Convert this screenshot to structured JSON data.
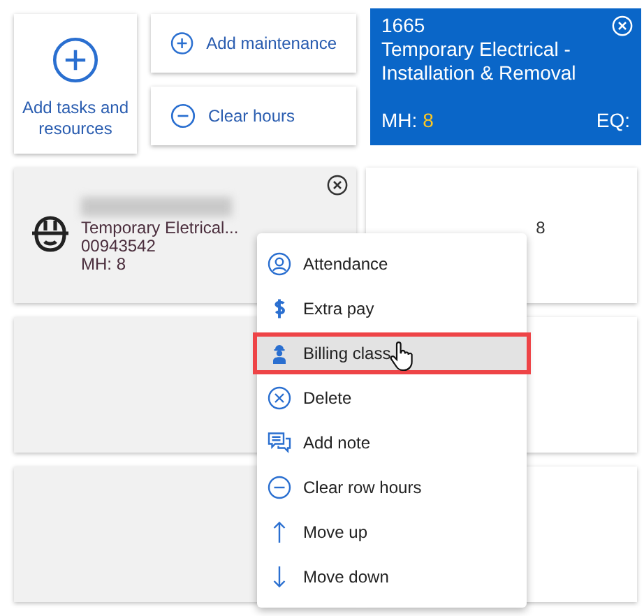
{
  "actions": {
    "add_tasks": "Add tasks and resources",
    "add_maintenance": "Add maintenance",
    "clear_hours": "Clear hours"
  },
  "task_card": {
    "number": "1665",
    "title": "Temporary Electrical - Installation & Removal",
    "mh_label": "MH:",
    "mh_value": "8",
    "eq_label": "EQ:"
  },
  "rows": [
    {
      "kind": "resource",
      "task": "Temporary Eletrical...",
      "id": "00943542",
      "mh": "MH: 8",
      "hours": "8"
    },
    {
      "kind": "empty"
    },
    {
      "kind": "empty"
    }
  ],
  "context_menu": {
    "items": [
      {
        "kind": "attendance",
        "label": "Attendance",
        "selected": false
      },
      {
        "kind": "pay",
        "label": "Extra pay",
        "selected": false
      },
      {
        "kind": "billing",
        "label": "Billing class",
        "selected": true
      },
      {
        "kind": "delete",
        "label": "Delete",
        "selected": false
      },
      {
        "kind": "note",
        "label": "Add note",
        "selected": false
      },
      {
        "kind": "clear",
        "label": "Clear row hours",
        "selected": false
      },
      {
        "kind": "up",
        "label": "Move up",
        "selected": false
      },
      {
        "kind": "down",
        "label": "Move down",
        "selected": false
      }
    ]
  }
}
